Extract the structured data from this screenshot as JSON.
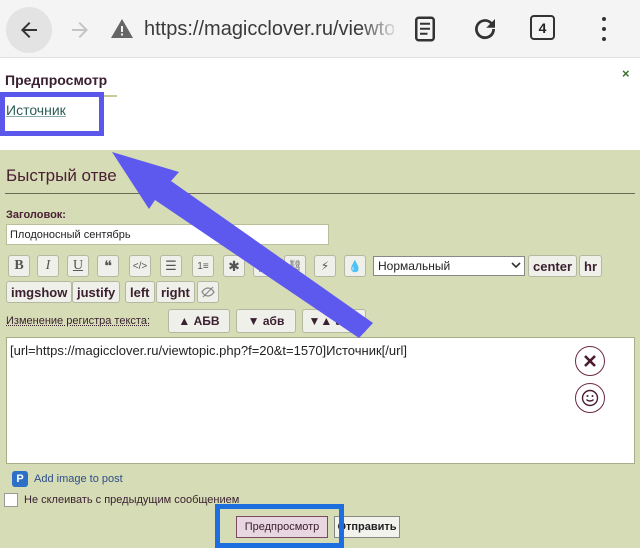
{
  "browser": {
    "url": "https://magicclover.ru/viewtopic.",
    "tab_count": "4",
    "back_icon": "arrow-left-icon",
    "forward_icon": "arrow-right-icon",
    "warning_icon": "warning-triangle-icon"
  },
  "preview": {
    "title": "Предпросмотр",
    "close": "×",
    "source_link": "Источник"
  },
  "quick_reply": {
    "title": "Быстрый отве",
    "subject_label": "Заголовок:",
    "subject_value": "Плодоносный сентябрь",
    "toolbar": {
      "bold": "B",
      "italic": "I",
      "underline": "U",
      "quote": "❝",
      "code": "</>",
      "list": "☰",
      "olist": "1≡",
      "star": "✱",
      "image": "▣",
      "link": "⛓",
      "flash": "⚡",
      "color": "💧",
      "size_selected": "Нормальный",
      "center": "center",
      "hr": "hr",
      "imgshow": "imgshow",
      "justify": "justify",
      "left": "left",
      "right": "right"
    },
    "case_label": "Изменение регистра текста:",
    "case_upper": "▲ АБВ",
    "case_lower": "▼ абв",
    "case_toggle": "▼▲ аБВ",
    "message": "[url=https://magicclover.ru/viewtopic.php?f=20&t=1570]Источник[/url]",
    "add_image": "Add image to post",
    "no_merge": "Не склеивать с предыдущим сообщением",
    "preview_button": "Предпросмотр",
    "send_button": "Отправить"
  },
  "colors": {
    "page_bg": "#d6dcb5",
    "highlight_source": "#5b57ea",
    "highlight_preview": "#1d6fe0",
    "arrow": "#5d58ee"
  }
}
